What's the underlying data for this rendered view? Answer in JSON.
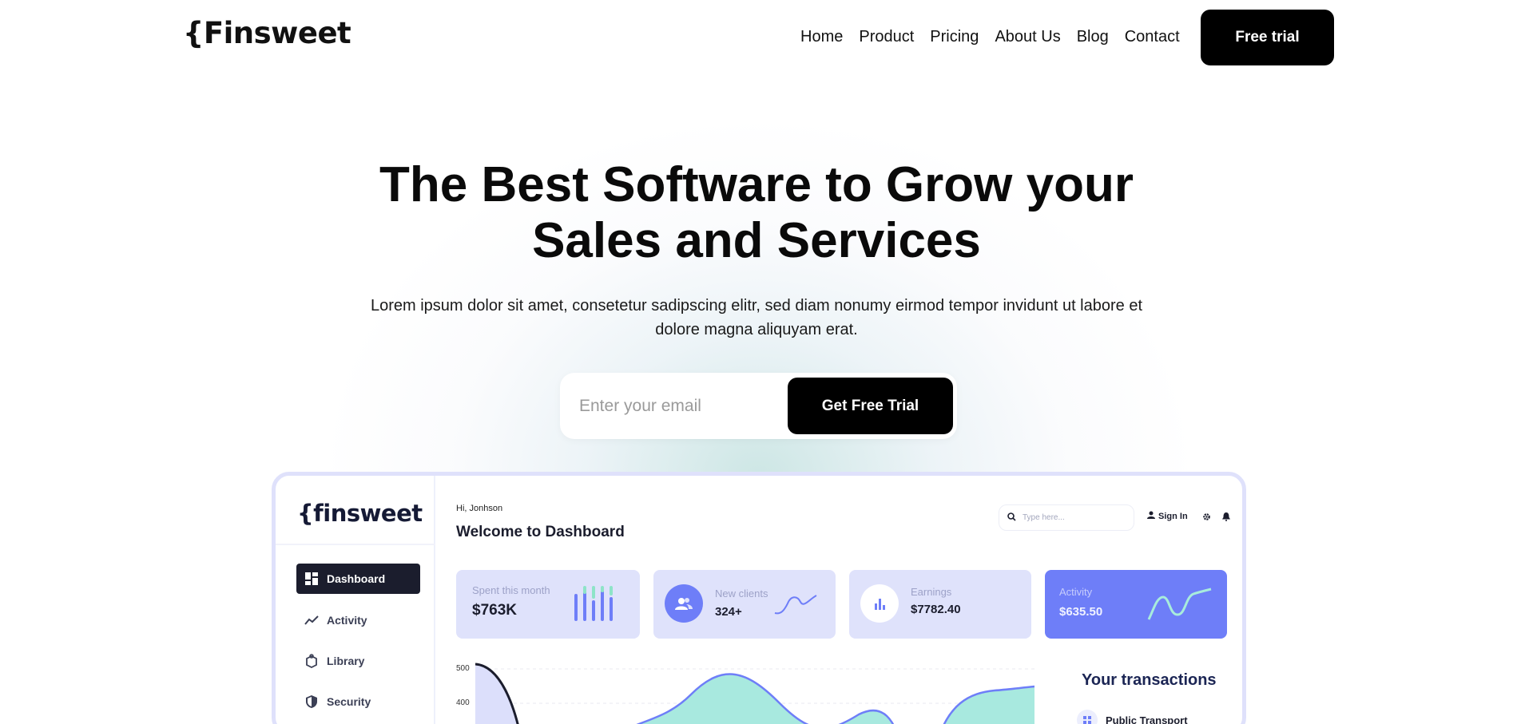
{
  "nav": {
    "logo": "{Finsweet",
    "links": [
      "Home",
      "Product",
      "Pricing",
      "About Us",
      "Blog",
      "Contact"
    ],
    "cta": "Free trial"
  },
  "hero": {
    "title_line1": "The Best Software to Grow your",
    "title_line2": "Sales and Services",
    "subtitle_line1": "Lorem ipsum dolor sit amet, consetetur sadipscing elitr, sed diam nonumy eirmod tempor invidunt ut labore et",
    "subtitle_line2": "dolore magna aliquyam erat.",
    "email_placeholder": "Enter your email",
    "cta": "Get Free Trial"
  },
  "dashboard": {
    "logo": "{finsweet",
    "sidebar": [
      {
        "label": "Dashboard",
        "icon": "grid-icon",
        "active": true
      },
      {
        "label": "Activity",
        "icon": "trend-icon",
        "active": false
      },
      {
        "label": "Library",
        "icon": "box-icon",
        "active": false
      },
      {
        "label": "Security",
        "icon": "shield-icon",
        "active": false
      }
    ],
    "greeting": "Hi, Jonhson",
    "title": "Welcome to Dashboard",
    "search_placeholder": "Type here...",
    "signin": "Sign In",
    "cards": [
      {
        "label": "Spent this month",
        "value": "$763K"
      },
      {
        "label": "New clients",
        "value": "324+"
      },
      {
        "label": "Earnings",
        "value": "$7782.40"
      },
      {
        "label": "Activity",
        "value": "$635.50"
      }
    ],
    "chart_ticks": [
      "500",
      "400"
    ],
    "transactions_title": "Your transactions",
    "transactions": [
      {
        "label": "Public Transport"
      }
    ],
    "colors": {
      "accent": "#6e7ef8",
      "card_bg": "#dfe2fb",
      "teal": "#a8e9df",
      "dark": "#1b1d2d"
    }
  }
}
